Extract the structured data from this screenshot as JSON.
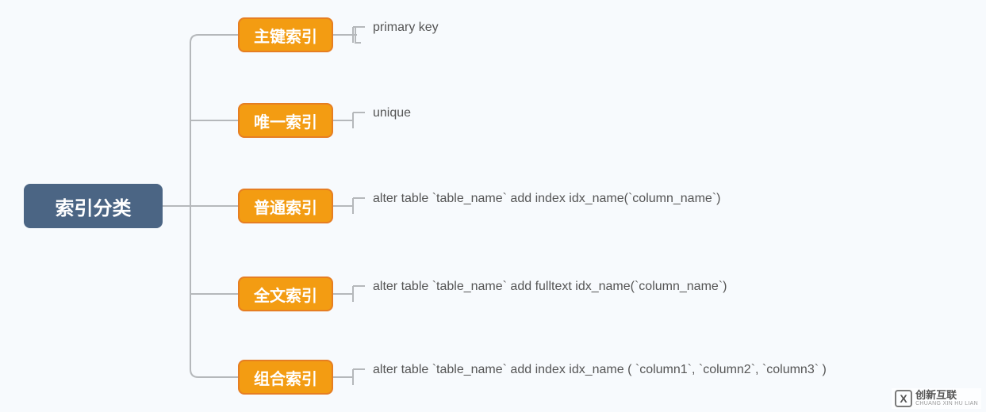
{
  "chart_data": {
    "type": "tree",
    "root": {
      "label": "索引分类"
    },
    "children": [
      {
        "label": "主键索引",
        "desc": "primary key"
      },
      {
        "label": "唯一索引",
        "desc": "unique"
      },
      {
        "label": "普通索引",
        "desc": "alter table `table_name` add index idx_name(`column_name`)"
      },
      {
        "label": "全文索引",
        "desc": "alter table `table_name` add fulltext idx_name(`column_name`)"
      },
      {
        "label": "组合索引",
        "desc": "alter table  `table_name`  add index idx_name (  `column1`,  `column2`,  `column3`  )"
      }
    ],
    "colors": {
      "root_bg": "#4b6584",
      "child_bg": "#f39c12",
      "child_border": "#e67e22",
      "connector": "#b5b8bb",
      "page_bg": "#f7fafd"
    }
  },
  "watermark": {
    "logo_letter": "X",
    "line1": "创新互联",
    "line2": "CHUANG XIN HU LIAN"
  }
}
